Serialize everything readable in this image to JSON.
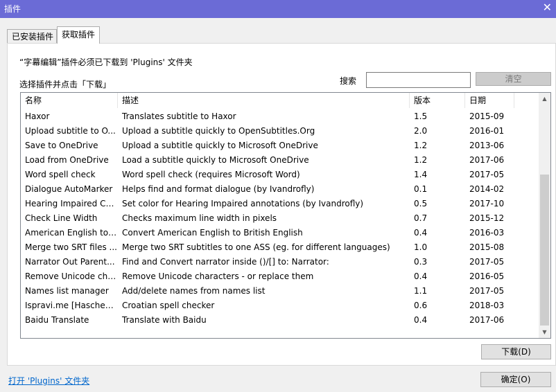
{
  "window": {
    "title": "插件",
    "close_icon": "close-icon"
  },
  "tabs": [
    {
      "label": "已安装插件",
      "active": false
    },
    {
      "label": "获取插件",
      "active": true
    }
  ],
  "notice": "“字幕编辑”插件必须已下载到 'Plugins' 文件夹",
  "select_label": "选择插件并点击「下载」",
  "search": {
    "label": "搜索",
    "value": "",
    "clear_label": "清空"
  },
  "table": {
    "columns": [
      "名称",
      "描述",
      "版本",
      "日期"
    ],
    "rows": [
      {
        "name": "Haxor",
        "desc": "Translates subtitle to Haxor",
        "ver": "1.5",
        "date": "2015-09"
      },
      {
        "name": "Upload subtitle to O...",
        "desc": "Upload a subtitle quickly to OpenSubtitles.Org",
        "ver": "2.0",
        "date": "2016-01"
      },
      {
        "name": "Save to  OneDrive",
        "desc": "Upload a subtitle quickly to Microsoft OneDrive",
        "ver": "1.2",
        "date": "2013-06"
      },
      {
        "name": "Load from OneDrive",
        "desc": "Load a subtitle quickly to Microsoft OneDrive",
        "ver": "1.2",
        "date": "2017-06"
      },
      {
        "name": "Word spell check",
        "desc": "Word spell check (requires Microsoft Word)",
        "ver": "1.4",
        "date": "2017-05"
      },
      {
        "name": "Dialogue AutoMarker",
        "desc": "Helps find and format dialogue (by Ivandrofly)",
        "ver": "0.1",
        "date": "2014-02"
      },
      {
        "name": "Hearing Impaired Co...",
        "desc": "Set color for Hearing Impaired annotations (by Ivandrofly)",
        "ver": "0.5",
        "date": "2017-10"
      },
      {
        "name": "Check Line Width",
        "desc": "Checks maximum line width in pixels",
        "ver": "0.7",
        "date": "2015-12"
      },
      {
        "name": "American English to ...",
        "desc": "Convert American English to British English",
        "ver": "0.4",
        "date": "2016-03"
      },
      {
        "name": "Merge two SRT files ...",
        "desc": "Merge two SRT subtitles to one ASS (eg. for different languages)",
        "ver": "1.0",
        "date": "2015-08"
      },
      {
        "name": "Narrator Out Parent...",
        "desc": "Find and Convert narrator inside ()/[] to: Narrator:",
        "ver": "0.3",
        "date": "2017-05"
      },
      {
        "name": "Remove Unicode cha...",
        "desc": "Remove Unicode characters - or replace them",
        "ver": "0.4",
        "date": "2016-05"
      },
      {
        "name": "Names list manager",
        "desc": "Add/delete names from names list",
        "ver": "1.1",
        "date": "2017-05"
      },
      {
        "name": "Ispravi.me [Hascheck...",
        "desc": "Croatian spell checker",
        "ver": "0.6",
        "date": "2018-03"
      },
      {
        "name": "Baidu Translate",
        "desc": "Translate with Baidu",
        "ver": "0.4",
        "date": "2017-06"
      }
    ]
  },
  "buttons": {
    "download": "下载(D)",
    "ok": "确定(O)"
  },
  "open_folder_link": "打开 'Plugins' 文件夹",
  "colors": {
    "titlebar": "#6b6bd6",
    "link": "#0066cc"
  }
}
